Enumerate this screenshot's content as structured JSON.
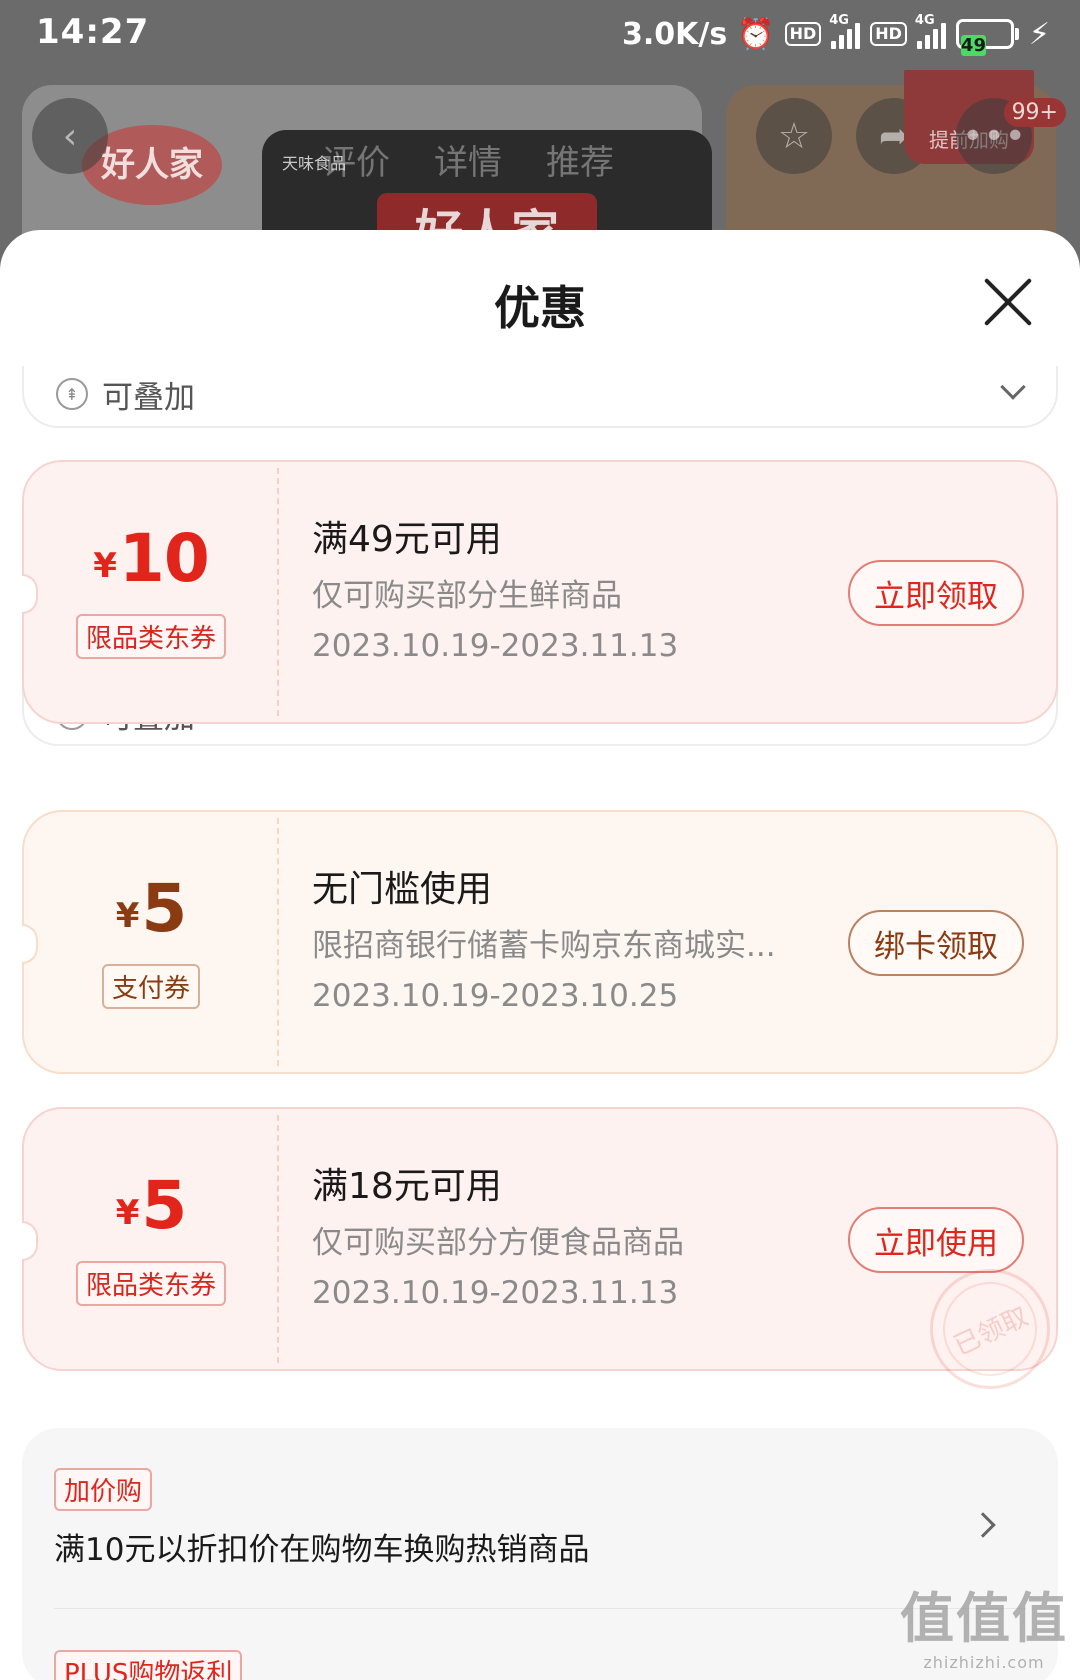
{
  "status_bar": {
    "time": "14:27",
    "net_speed": "3.0K/s",
    "hd1": "HD",
    "hd2": "HD",
    "net1": "4G",
    "net2": "4G",
    "battery": "49"
  },
  "backdrop": {
    "brand_logo": "好人家",
    "brand_small": "天味食品",
    "bag_label": "好人家",
    "tabs": [
      "评价",
      "详情",
      "推荐"
    ],
    "promo": "提前加购",
    "badge": "99+"
  },
  "sheet": {
    "title": "优惠",
    "stack_label": "可叠加"
  },
  "coupons": [
    {
      "yen": "¥",
      "amount": "10",
      "tag": "限品类东券",
      "title": "满49元可用",
      "desc": "仅可购买部分生鲜商品",
      "date": "2023.10.19-2023.11.13",
      "button": "立即领取"
    },
    {
      "yen": "¥",
      "amount": "5",
      "tag": "支付券",
      "title": "无门槛使用",
      "desc": "限招商银行储蓄卡购京东商城实...",
      "date": "2023.10.19-2023.10.25",
      "button": "绑卡领取"
    },
    {
      "yen": "¥",
      "amount": "5",
      "tag": "限品类东券",
      "title": "满18元可用",
      "desc": "仅可购买部分方便食品商品",
      "date": "2023.10.19-2023.11.13",
      "button": "立即使用",
      "stamp": "已领取"
    }
  ],
  "addon": {
    "tag": "加价购",
    "text": "满10元以折扣价在购物车换购热销商品",
    "tag2": "PLUS购物返利"
  },
  "watermark": {
    "main": "值值值",
    "sub": "zhizhizhi.com"
  },
  "colors": {
    "accent_red": "#e1251b",
    "pay_brown": "#8a3b12",
    "coupon_bg": "#fef2f0"
  }
}
